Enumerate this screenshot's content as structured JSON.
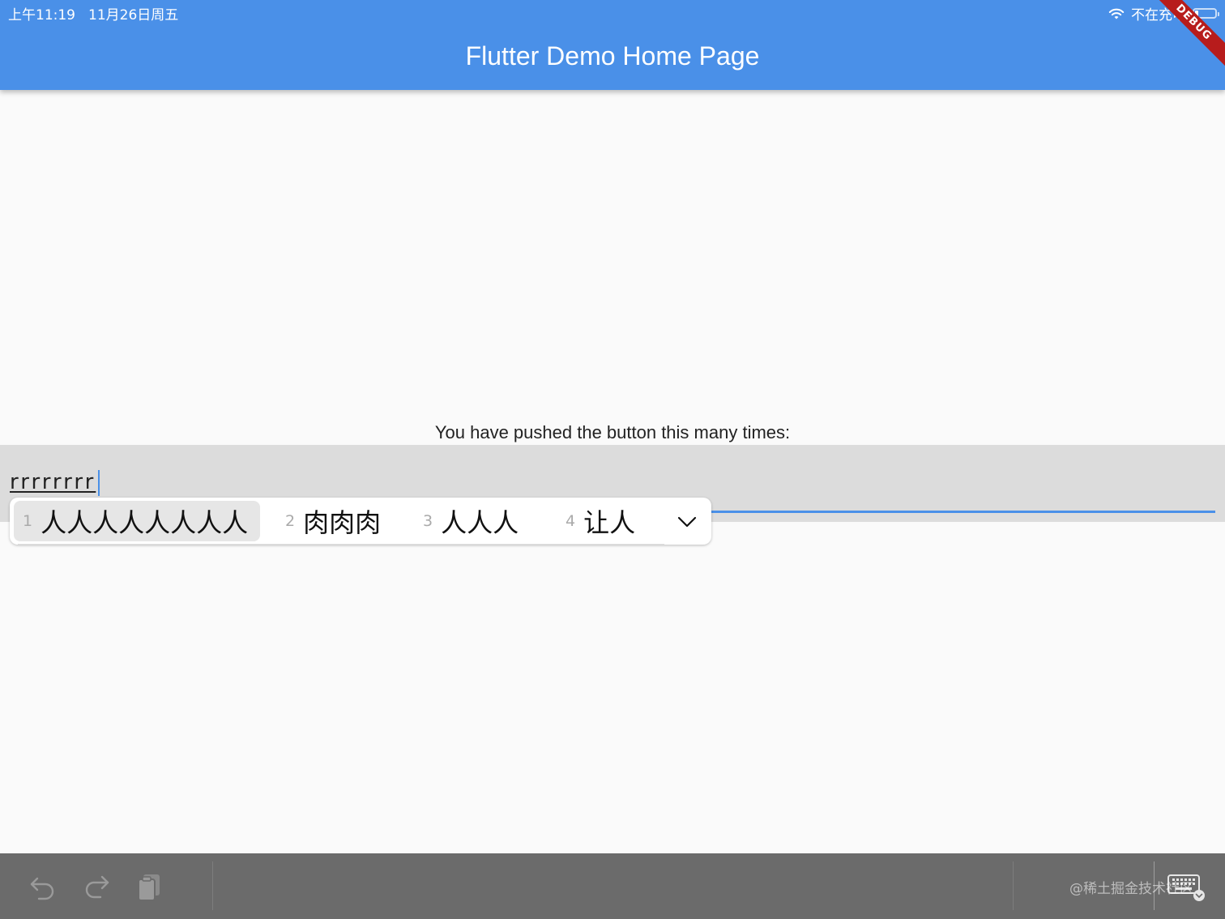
{
  "status_bar": {
    "time": "上午11:19",
    "date": "11月26日周五",
    "charging_status": "不在充电",
    "wifi_icon": "wifi-icon",
    "battery_level": 0.15
  },
  "app_bar": {
    "title": "Flutter Demo Home Page",
    "debug_banner": "DEBUG"
  },
  "main": {
    "counter_label": "You have pushed the button this many times:"
  },
  "text_field": {
    "value": "rrrrrrrr",
    "accent_color": "#4a90e8"
  },
  "candidate_bar": {
    "candidates": [
      {
        "index": "1",
        "text": "人人人人人人人人",
        "selected": true
      },
      {
        "index": "2",
        "text": "肉肉肉"
      },
      {
        "index": "3",
        "text": "人人人"
      },
      {
        "index": "4",
        "text": "让人"
      }
    ],
    "expand_icon": "chevron-down-icon"
  },
  "keyboard_bar": {
    "icons": [
      "undo-icon",
      "redo-icon",
      "paste-icon",
      "keyboard-hide-icon"
    ],
    "watermark": "@稀土掘金技术社区"
  }
}
